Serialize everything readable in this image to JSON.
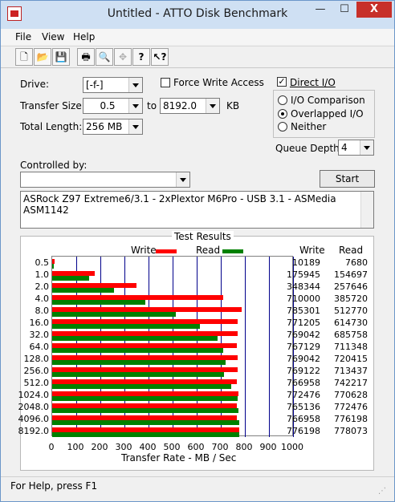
{
  "window": {
    "title": "Untitled - ATTO Disk Benchmark",
    "controls": {
      "minimize": "—",
      "maximize": "☐",
      "close": "X"
    }
  },
  "menu": [
    {
      "label": "File"
    },
    {
      "label": "View"
    },
    {
      "label": "Help"
    }
  ],
  "toolbar": [
    {
      "name": "new-file-icon",
      "glyph": "🗋"
    },
    {
      "name": "open-folder-icon",
      "glyph": "📂"
    },
    {
      "name": "save-icon",
      "glyph": "💾"
    },
    {
      "name": "print-icon",
      "glyph": "🖶"
    },
    {
      "name": "print-preview-icon",
      "glyph": "🔍"
    },
    {
      "name": "move-icon",
      "glyph": "✥"
    },
    {
      "name": "help-icon",
      "glyph": "?"
    },
    {
      "name": "context-help-icon",
      "glyph": "↖?"
    }
  ],
  "form": {
    "drive_label": "Drive:",
    "drive_value": "[-f-]",
    "force_write_label": "Force Write Access",
    "force_write_checked": false,
    "transfer_size_label": "Transfer Size:",
    "transfer_from": "0.5",
    "to_label": "to",
    "transfer_to": "8192.0",
    "kb_label": "KB",
    "total_length_label": "Total Length:",
    "total_length_value": "256 MB",
    "direct_io_label": "Direct I/O",
    "direct_io_checked": true,
    "io_comparison_label": "I/O Comparison",
    "overlapped_io_label": "Overlapped I/O",
    "neither_label": "Neither",
    "selected_mode": "overlapped",
    "queue_depth_label": "Queue Depth:",
    "queue_depth_value": "4",
    "controlled_by_label": "Controlled by:",
    "controlled_by_value": "",
    "start_label": "Start",
    "description": "ASRock Z97 Extreme6/3.1 - 2xPlextor M6Pro - USB 3.1 - ASMedia ASM1142"
  },
  "results": {
    "title": "Test Results",
    "legend_write": "Write",
    "legend_read": "Read",
    "col_write": "Write",
    "col_read": "Read",
    "write_color": "#ff0000",
    "read_color": "#008000",
    "gridline_color": "#00008b",
    "xlabel": "Transfer Rate - MB / Sec"
  },
  "chart_data": {
    "type": "bar",
    "categories": [
      "0.5",
      "1.0",
      "2.0",
      "4.0",
      "8.0",
      "16.0",
      "32.0",
      "64.0",
      "128.0",
      "256.0",
      "512.0",
      "1024.0",
      "2048.0",
      "4096.0",
      "8192.0"
    ],
    "series": [
      {
        "name": "Write",
        "values": [
          10189,
          175945,
          348344,
          710000,
          785301,
          771205,
          769042,
          767129,
          769042,
          769122,
          766958,
          772476,
          765136,
          766958,
          776198
        ],
        "labels": [
          "10189",
          "175945",
          "348344",
          "710000",
          "785301",
          "771205",
          "769042",
          "767129",
          "769042",
          "769122",
          "766958",
          "772476",
          "765136",
          "766958",
          "776198"
        ]
      },
      {
        "name": "Read",
        "values": [
          7680,
          154697,
          257646,
          385720,
          512770,
          614730,
          685758,
          711348,
          720415,
          713437,
          742217,
          770628,
          772476,
          776198,
          778073
        ],
        "labels": [
          "7680",
          "154697",
          "257646",
          "385720",
          "512770",
          "614730",
          "685758",
          "711348",
          "720415",
          "713437",
          "742217",
          "770628",
          "772476",
          "776198",
          "778073"
        ]
      }
    ],
    "xticks": [
      "0",
      "100",
      "200",
      "300",
      "400",
      "500",
      "600",
      "700",
      "800",
      "900",
      "1000"
    ],
    "xlim": [
      0,
      1000
    ],
    "xlabel": "Transfer Rate - MB / Sec",
    "grid": true,
    "legend": "top"
  },
  "status": "For Help, press F1"
}
